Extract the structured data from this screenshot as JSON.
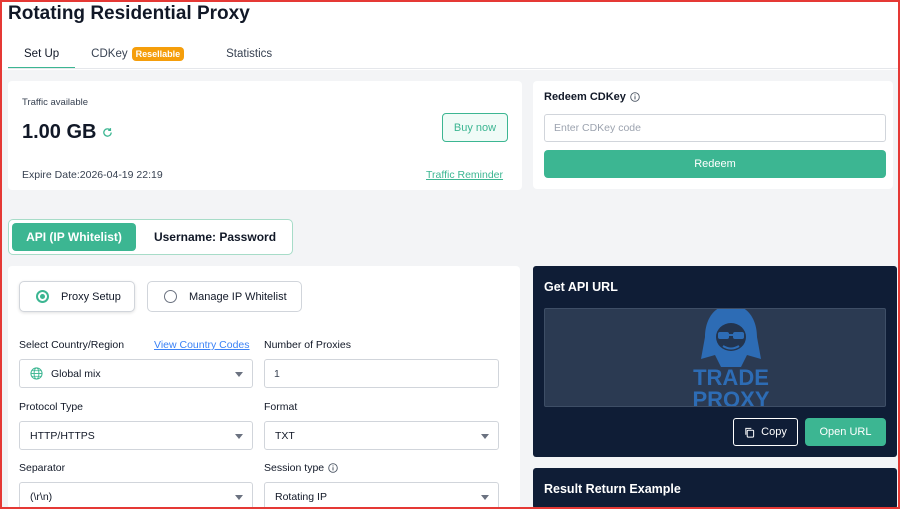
{
  "page": {
    "title": "Rotating Residential Proxy"
  },
  "tabs": [
    {
      "label": "Set Up",
      "active": true
    },
    {
      "label": "CDKey",
      "badge": "Resellable"
    },
    {
      "label": "Statistics"
    }
  ],
  "traffic": {
    "label": "Traffic available",
    "value": "1.00 GB",
    "buy_label": "Buy now",
    "expire_label": "Expire Date:",
    "expire_value": "2026-04-19 22:19",
    "reminder_label": "Traffic Reminder"
  },
  "redeem": {
    "title": "Redeem CDKey",
    "placeholder": "Enter CDKey code",
    "button": "Redeem"
  },
  "mode_toggle": {
    "active": "API (IP Whitelist)",
    "inactive": "Username: Password"
  },
  "setup_options": {
    "proxy_setup": "Proxy Setup",
    "manage_whitelist": "Manage IP Whitelist"
  },
  "form": {
    "country_label": "Select Country/Region",
    "country_codes_link": "View Country Codes",
    "country_value": "Global mix",
    "proxies_label": "Number of Proxies",
    "proxies_value": "1",
    "protocol_label": "Protocol Type",
    "protocol_value": "HTTP/HTTPS",
    "format_label": "Format",
    "format_value": "TXT",
    "separator_label": "Separator",
    "separator_value": "(\\r\\n)",
    "session_label": "Session type",
    "session_value": "Rotating IP"
  },
  "api": {
    "title": "Get API URL",
    "copy_label": "Copy",
    "open_label": "Open URL"
  },
  "watermark": {
    "line1": "TRADE",
    "line2": "PROXY"
  },
  "result": {
    "title": "Result Return Example"
  },
  "colors": {
    "accent": "#3cb692",
    "dark_panel": "#0f1d36",
    "badge": "#f59e0b",
    "link": "#3b82f6"
  }
}
